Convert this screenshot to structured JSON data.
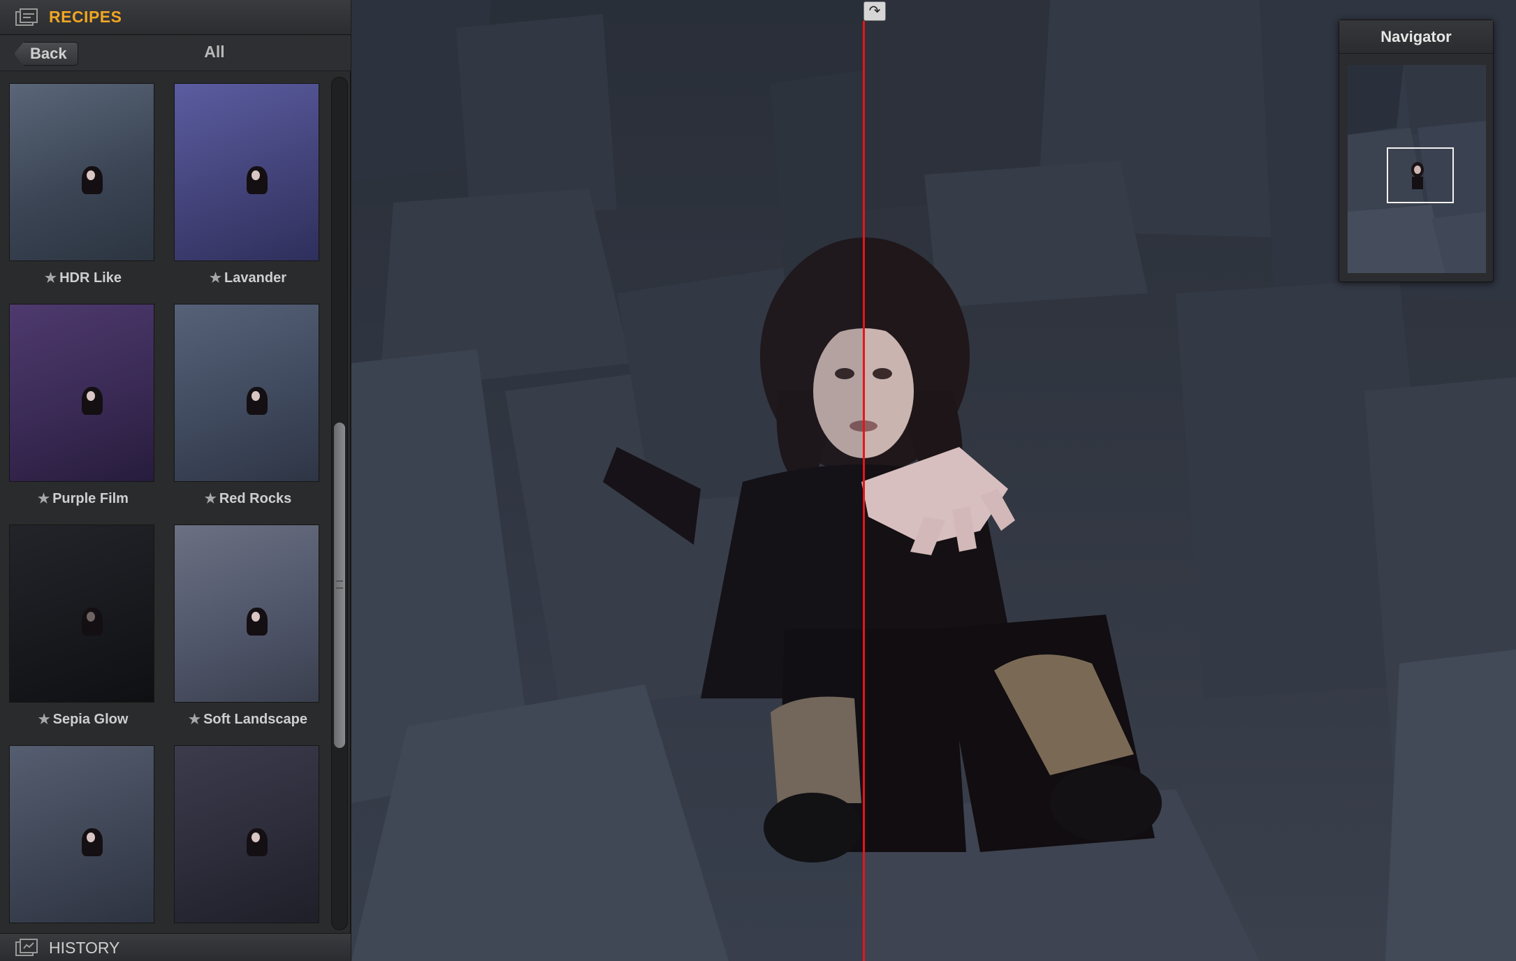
{
  "header": {
    "title": "RECIPES",
    "icon": "recipes-panel-icon"
  },
  "subbar": {
    "back_label": "Back",
    "filter_title": "All"
  },
  "recipes": [
    {
      "label": "HDR Like",
      "tint": "#4a5566",
      "starred": true
    },
    {
      "label": "Lavander",
      "tint": "#4a4a86",
      "starred": true
    },
    {
      "label": "Purple Film",
      "tint": "#3e2d52",
      "starred": true
    },
    {
      "label": "Red Rocks",
      "tint": "#404a5e",
      "starred": true
    },
    {
      "label": "Sepia Glow",
      "tint": "#1a1b1e",
      "starred": true
    },
    {
      "label": "Soft Landscape",
      "tint": "#555a68",
      "starred": true
    },
    {
      "label": "",
      "tint": "#3f4656",
      "starred": false
    },
    {
      "label": "",
      "tint": "#2c2c3a",
      "starred": false
    }
  ],
  "star_glyph": "★",
  "history": {
    "title": "HISTORY",
    "icon": "history-panel-icon"
  },
  "navigator": {
    "title": "Navigator"
  },
  "split": {
    "handle_glyph": "↷",
    "line_color": "#e8141b"
  },
  "colors": {
    "accent": "#f0a623"
  }
}
